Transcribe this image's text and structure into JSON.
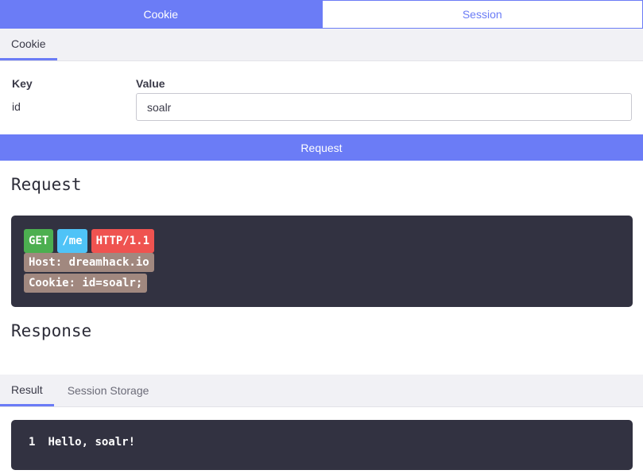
{
  "top_tabs": {
    "cookie": "Cookie",
    "session": "Session"
  },
  "sub_tabs": {
    "cookie": "Cookie"
  },
  "kv": {
    "key_header": "Key",
    "value_header": "Value",
    "key": "id",
    "value": "soalr"
  },
  "request_button": "Request",
  "request_title": "Request",
  "request_line": {
    "method": "GET",
    "path": "/me",
    "protocol": "HTTP/1.1"
  },
  "request_headers": [
    "Host: dreamhack.io",
    "Cookie: id=soalr;"
  ],
  "response_title": "Response",
  "result_tabs": {
    "result": "Result",
    "session_storage": "Session Storage"
  },
  "result": {
    "line_number": "1",
    "text": "Hello, soalr!"
  },
  "colors": {
    "accent": "#6b7cf6",
    "code_bg": "#323241",
    "get": "#4caf50",
    "path": "#4fc3f7",
    "protocol": "#ef5350",
    "header": "#a1887f"
  }
}
